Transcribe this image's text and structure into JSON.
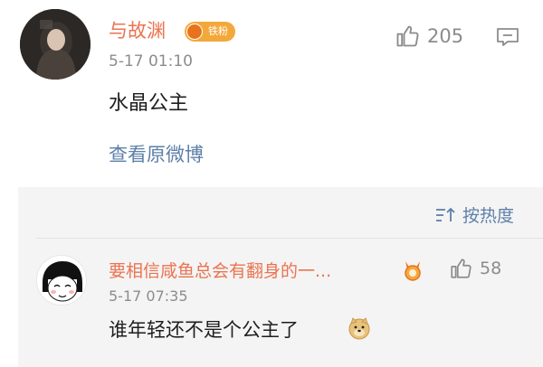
{
  "top_comment": {
    "username": "与故渊",
    "badge_text": "铁粉",
    "time": "5-17 01:10",
    "content": "水晶公主",
    "like_count": "205",
    "view_original_label": "查看原微博"
  },
  "sort": {
    "label": "按热度"
  },
  "reply": {
    "username": "要相信咸鱼总会有翻身的一...",
    "time": "5-17 07:35",
    "content": "谁年轻还不是个公主了",
    "like_count": "58"
  },
  "colors": {
    "username": "#eb7350",
    "link": "#5d7fa8",
    "muted": "#8c8c8c",
    "sub_background": "#f4f4f4"
  },
  "icons": {
    "like": "thumbs-up-icon",
    "reply": "comment-bubble-icon",
    "sort": "sort-icon",
    "medal": "fan-medal-icon",
    "emoji": "doge-emoji-icon"
  }
}
